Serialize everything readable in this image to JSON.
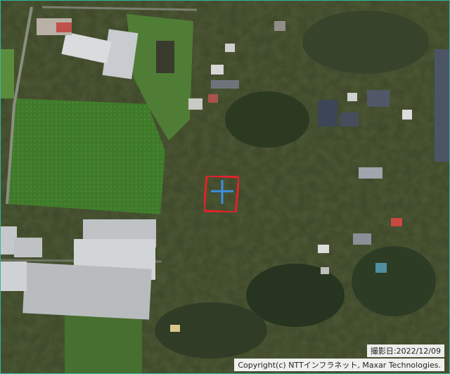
{
  "map": {
    "type": "aerial-photo",
    "marker": {
      "shape": "rectangle-with-crosshair",
      "outline_color": "#e8202a",
      "cross_color": "#3d8fe0"
    },
    "capture_date_label": "撮影日:2022/12/09",
    "copyright": "Copyright(c) NTTインフラネット, Maxar Technologies.",
    "accent_color": "#2fb7a0"
  }
}
